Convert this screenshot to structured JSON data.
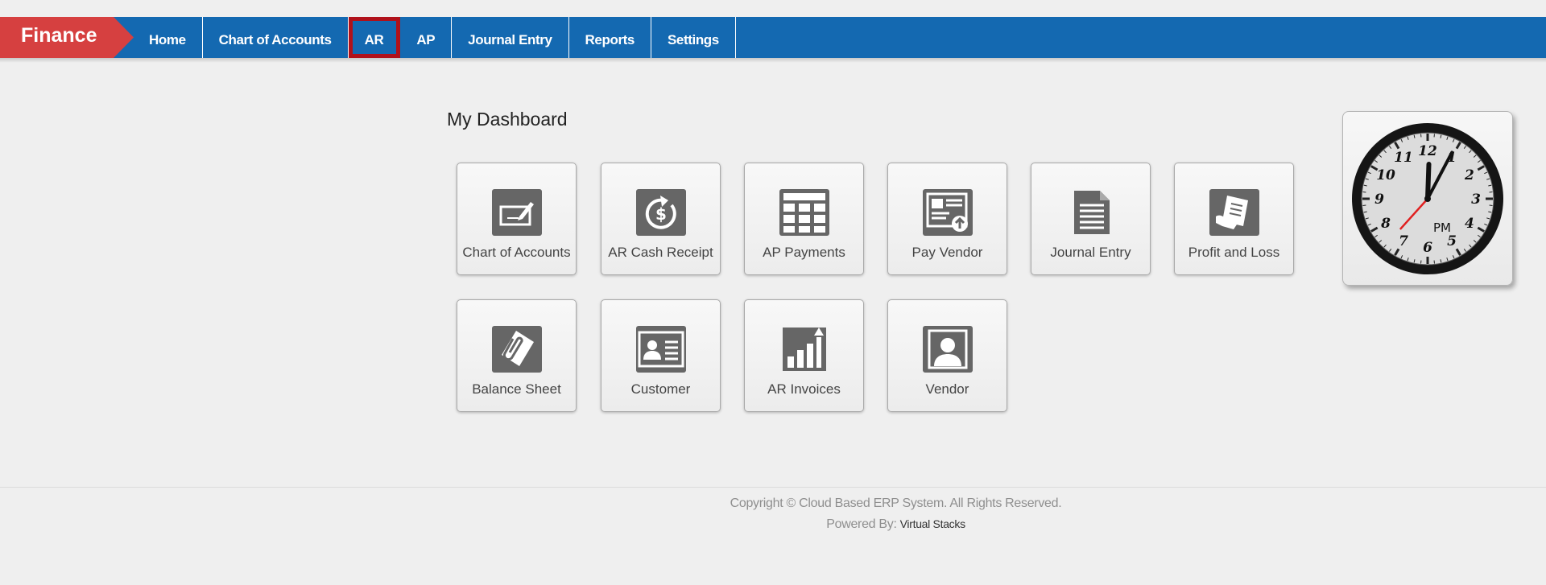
{
  "brand": {
    "label": "Finance",
    "color": "#d64040"
  },
  "nav": {
    "bar_color": "#1469b1",
    "items": [
      {
        "label": "Home"
      },
      {
        "label": "Chart of Accounts"
      },
      {
        "label": "AR",
        "active": true,
        "highlight_color": "#b0111a"
      },
      {
        "label": "AP"
      },
      {
        "label": "Journal Entry"
      },
      {
        "label": "Reports"
      },
      {
        "label": "Settings"
      }
    ]
  },
  "dashboard": {
    "title": "My Dashboard",
    "tiles": [
      {
        "label": "Chart of Accounts",
        "icon": "check-writing-icon"
      },
      {
        "label": "AR Cash Receipt",
        "icon": "dollar-refresh-icon"
      },
      {
        "label": "AP Payments",
        "icon": "calculator-grid-icon"
      },
      {
        "label": "Pay Vendor",
        "icon": "invoice-upload-icon"
      },
      {
        "label": "Journal Entry",
        "icon": "document-lines-icon"
      },
      {
        "label": "Profit and Loss",
        "icon": "hand-receipt-icon"
      },
      {
        "label": "Balance Sheet",
        "icon": "paperclip-card-icon"
      },
      {
        "label": "Customer",
        "icon": "contact-card-icon"
      },
      {
        "label": "AR Invoices",
        "icon": "bar-chart-up-icon"
      },
      {
        "label": "Vendor",
        "icon": "person-icon"
      }
    ]
  },
  "clock": {
    "period": "PM",
    "numerals": [
      "12",
      "1",
      "2",
      "3",
      "4",
      "5",
      "6",
      "7",
      "8",
      "9",
      "10",
      "11"
    ],
    "time": "12:04:37"
  },
  "footer": {
    "copyright": "Copyright © Cloud Based ERP System. All Rights Reserved.",
    "powered_by_label": "Powered By:",
    "powered_by_name": "Virtual Stacks"
  }
}
